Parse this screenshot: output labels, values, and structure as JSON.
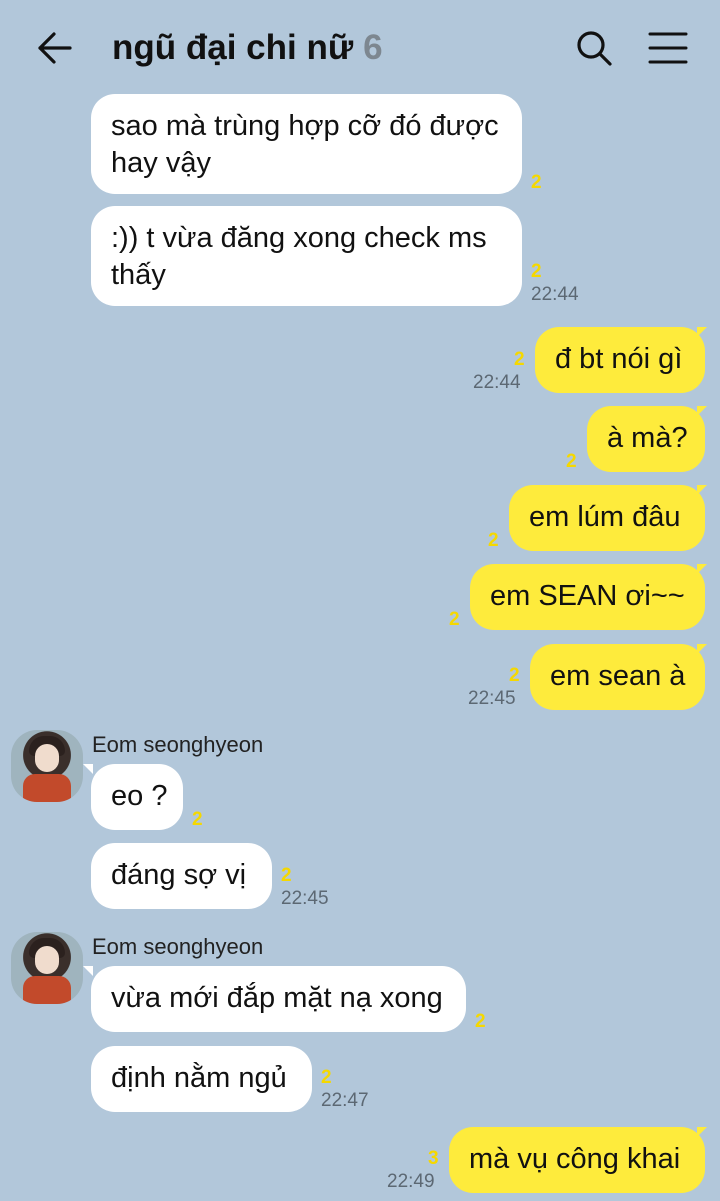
{
  "header": {
    "title": "ngũ đại chi nữ",
    "member_count": "6"
  },
  "messages": [
    {
      "text1": "sao mà trùng hợp cỡ đó được",
      "text2": "hay vậy",
      "unread": "2"
    },
    {
      "text1": ":)) t vừa đăng xong check ms",
      "text2": "thấy",
      "unread": "2",
      "time": "22:44"
    },
    {
      "text": "đ bt nói gì",
      "unread": "2",
      "time": "22:44"
    },
    {
      "text": "à mà?",
      "unread": "2"
    },
    {
      "text": "em lúm đâu",
      "unread": "2"
    },
    {
      "text": "em SEAN ơi~~",
      "unread": "2"
    },
    {
      "text": "em sean à",
      "unread": "2",
      "time": "22:45"
    },
    {
      "sender": "Eom seonghyeon",
      "text": "eo ?",
      "unread": "2"
    },
    {
      "text": "đáng sợ vị",
      "unread": "2",
      "time": "22:45"
    },
    {
      "sender": "Eom seonghyeon",
      "text": "vừa mới đắp mặt nạ xong",
      "unread": "2"
    },
    {
      "text": "định nằm ngủ",
      "unread": "2",
      "time": "22:47"
    },
    {
      "text": "mà vụ công khai",
      "unread": "3",
      "time": "22:49"
    }
  ],
  "icons": {
    "back": "arrow-left-icon",
    "search": "search-icon",
    "menu": "hamburger-menu-icon"
  },
  "colors": {
    "background": "#B2C7DA",
    "outgoing_bubble": "#FEEB3C",
    "incoming_bubble": "#FFFFFF",
    "unread": "#F5D800"
  }
}
